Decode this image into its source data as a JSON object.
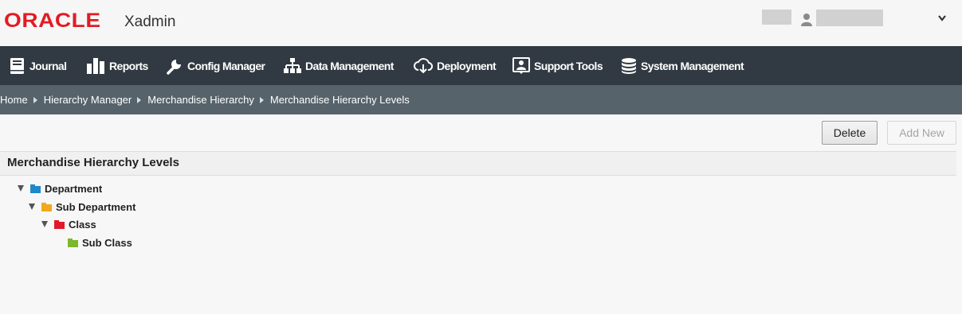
{
  "header": {
    "logo": "ORACLE",
    "app_name": "Xadmin"
  },
  "nav": {
    "items": [
      {
        "label": "Journal",
        "icon": "journal-icon"
      },
      {
        "label": "Reports",
        "icon": "bar-chart-icon"
      },
      {
        "label": "Config Manager",
        "icon": "wrench-icon"
      },
      {
        "label": "Data Management",
        "icon": "hierarchy-icon"
      },
      {
        "label": "Deployment",
        "icon": "cloud-download-icon"
      },
      {
        "label": "Support Tools",
        "icon": "support-icon"
      },
      {
        "label": "System Management",
        "icon": "database-icon"
      }
    ]
  },
  "breadcrumb": {
    "items": [
      "Home",
      "Hierarchy Manager",
      "Merchandise Hierarchy",
      "Merchandise Hierarchy Levels"
    ]
  },
  "toolbar": {
    "delete_label": "Delete",
    "add_new_label": "Add New"
  },
  "panel": {
    "title": "Merchandise Hierarchy Levels"
  },
  "tree": {
    "nodes": [
      {
        "label": "Department",
        "color": "#1e88c9",
        "expanded": true
      },
      {
        "label": "Sub Department",
        "color": "#f0a81c",
        "expanded": true
      },
      {
        "label": "Class",
        "color": "#e2192a",
        "expanded": true
      },
      {
        "label": "Sub Class",
        "color": "#7cb82b",
        "expanded": false
      }
    ]
  },
  "colors": {
    "brand": "#e31b23",
    "nav_bg": "#313a42",
    "breadcrumb_bg": "#56636b"
  }
}
